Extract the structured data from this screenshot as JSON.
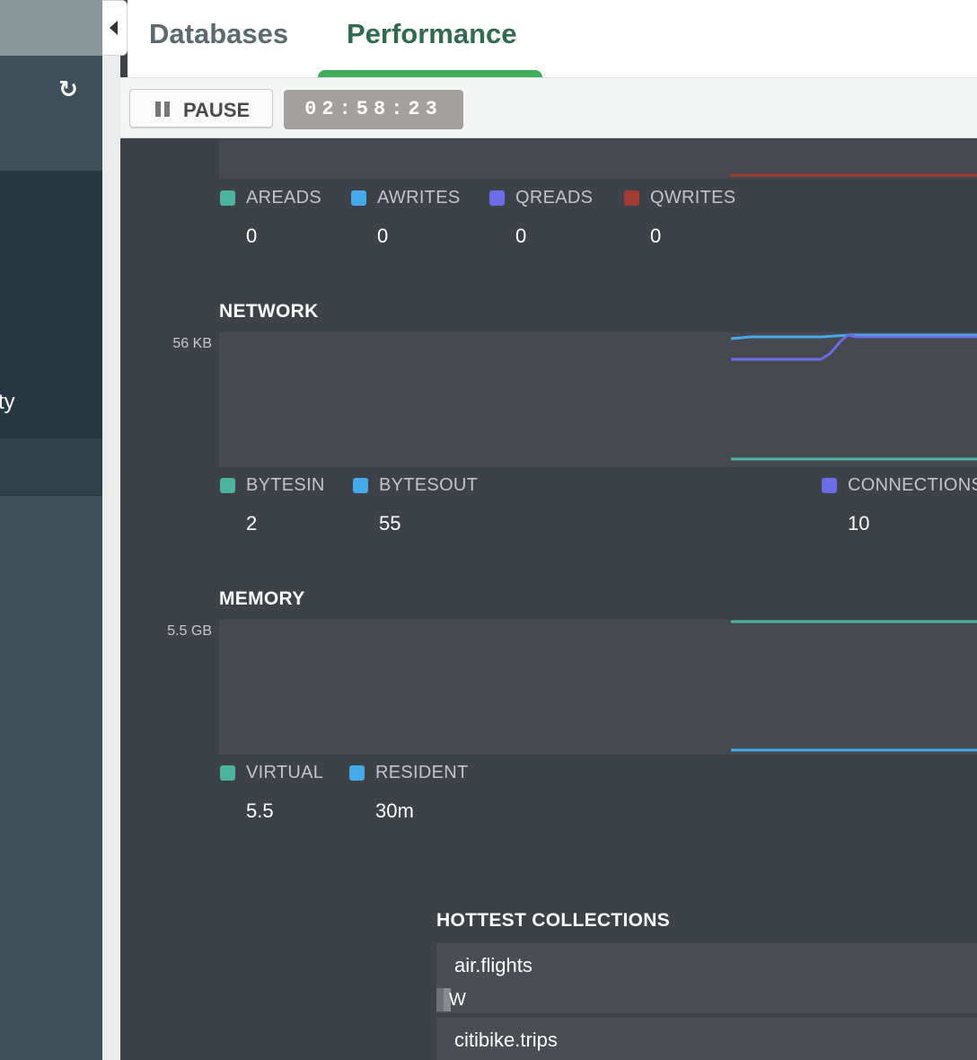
{
  "sidebar": {
    "refresh_icon": "refresh-icon",
    "partial_label": "ty"
  },
  "tabs": {
    "databases": "Databases",
    "performance": "Performance",
    "active": "Performance"
  },
  "toolbar": {
    "pause_label": "PAUSE",
    "timer": "02:58:23"
  },
  "operations": {
    "legend": [
      {
        "name": "AREADS",
        "value": "0",
        "color": "#4db3a1"
      },
      {
        "name": "AWRITES",
        "value": "0",
        "color": "#46a9ea"
      },
      {
        "name": "QREADS",
        "value": "0",
        "color": "#6b6de6"
      },
      {
        "name": "QWRITES",
        "value": "0",
        "color": "#a43b33"
      }
    ]
  },
  "network": {
    "title": "NETWORK",
    "y_max_label": "56 KB",
    "legend": [
      {
        "name": "BYTESIN",
        "value": "2",
        "color": "#4db3a1"
      },
      {
        "name": "BYTESOUT",
        "value": "55",
        "color": "#46a9ea"
      },
      {
        "name": "CONNECTIONS",
        "value": "10",
        "color": "#6b6de6"
      }
    ]
  },
  "memory": {
    "title": "MEMORY",
    "y_max_label": "5.5 GB",
    "legend": [
      {
        "name": "VIRTUAL",
        "value": "5.5",
        "color": "#4db3a1"
      },
      {
        "name": "RESIDENT",
        "value": "30m",
        "color": "#46a9ea"
      }
    ]
  },
  "hottest_collections": {
    "title": "HOTTEST COLLECTIONS",
    "items": [
      {
        "name": "air.flights",
        "sub": "W"
      },
      {
        "name": "citibike.trips",
        "sub": ""
      }
    ]
  }
}
